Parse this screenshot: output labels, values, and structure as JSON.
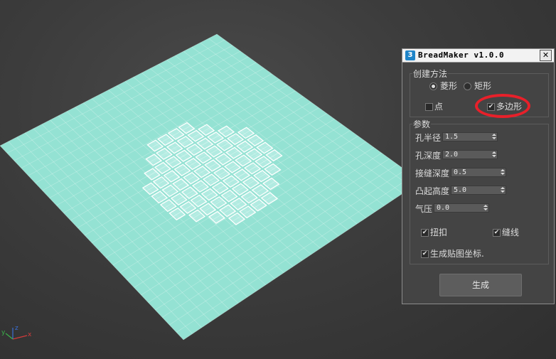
{
  "dialog": {
    "title": "BreadMaker v1.0.0",
    "logo_text": "3",
    "close_label": "✕",
    "create_group": {
      "label": "创建方法",
      "radio_diamond": "菱形",
      "radio_rect": "矩形",
      "checkbox_point": "点",
      "checkbox_polygon": "多边形"
    },
    "params_group": {
      "label": "参数",
      "hole_radius_label": "孔半径",
      "hole_radius_value": "1.5",
      "hole_depth_label": "孔深度",
      "hole_depth_value": "2.0",
      "seam_depth_label": "接缝深度",
      "seam_depth_value": "0.5",
      "bulge_height_label": "凸起高度",
      "bulge_height_value": "5.0",
      "pressure_label": "气压",
      "pressure_value": "0.0",
      "twist_label": "扭扣",
      "seam_label": "缝线",
      "gen_uv_label": "生成贴图坐标."
    },
    "generate_label": "生成"
  },
  "gizmo": {
    "x_label": "x",
    "y_label": "y",
    "z_label": "z"
  },
  "colors": {
    "mesh_fill": "#94e2d3",
    "wire": "#ffffff",
    "highlight": "#e8202a"
  }
}
